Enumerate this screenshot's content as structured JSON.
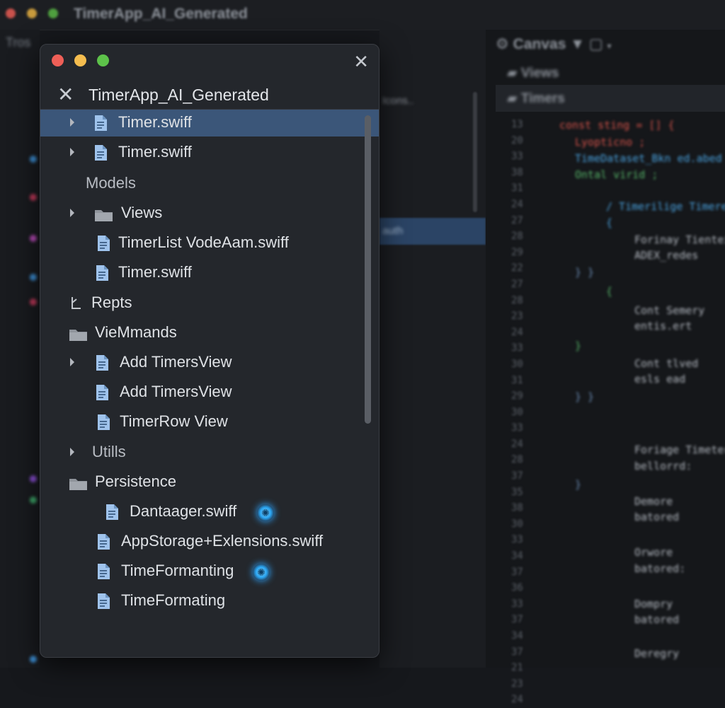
{
  "window": {
    "title": "TimerApp_AI_Generated"
  },
  "background": {
    "left_tab": "Tros",
    "middle_texts": [
      "Icons..",
      "auth"
    ],
    "canvas_label": "Canvas",
    "right_rows": [
      "Views",
      "Timers"
    ],
    "gutter_numbers": [
      "13",
      "20",
      "33",
      "38",
      "31",
      "24",
      "27",
      "28",
      "29",
      "22",
      "27",
      "28",
      "23",
      "24",
      "33",
      "30",
      "31",
      "29",
      "30",
      "33",
      "24",
      "28",
      "37",
      "35",
      "38",
      "30",
      "33",
      "34",
      "37",
      "36",
      "33",
      "37",
      "34",
      "37",
      "21",
      "23",
      "24"
    ],
    "code": [
      "const sting = [] {",
      "  Lyopticno ;",
      "  TimeDataset_Bkn ed.abed {",
      "  Ontal virid ;",
      "/ Timerilige Timeres",
      "{",
      "Forinay Tienteint",
      "ADEX_redes",
      "} }",
      "{",
      "Cont Semery",
      "entis.ert",
      "}",
      "Cont tlved",
      "esls ead",
      "} }",
      "Foriage Timeter",
      "bellorrd:",
      "}",
      "Demore",
      "batored",
      "Orwore",
      "batored:",
      "Dompry",
      "batored",
      "Deregry"
    ]
  },
  "panel": {
    "project_name": "TimerApp_AI_Generated",
    "items": [
      {
        "label": "Timer.swiff",
        "kind": "file",
        "chevron": true,
        "selected": true
      },
      {
        "label": "Timer.swiff",
        "kind": "file",
        "chevron": true
      },
      {
        "label": "Models",
        "kind": "group"
      },
      {
        "label": "Views",
        "kind": "folder",
        "chevron": true
      },
      {
        "label": "TimerList VodeAam.swiff",
        "kind": "file"
      },
      {
        "label": "Timer.swiff",
        "kind": "file"
      },
      {
        "label": "Repts",
        "kind": "person"
      },
      {
        "label": "VieMmands",
        "kind": "folder"
      },
      {
        "label": "Add TimersView",
        "kind": "file",
        "chevron": true
      },
      {
        "label": "Add TimersView",
        "kind": "file"
      },
      {
        "label": "TimerRow View",
        "kind": "file"
      },
      {
        "label": "Utills",
        "kind": "group",
        "chevron": true
      },
      {
        "label": "Persistence",
        "kind": "folder"
      },
      {
        "label": "Dantaager.swiff",
        "kind": "file",
        "badge": "ai-sparkle-icon"
      },
      {
        "label": "AppStorage+Exlensions.swiff",
        "kind": "file"
      },
      {
        "label": "TimeFormanting",
        "kind": "file",
        "badge": "ai-sparkle-icon"
      },
      {
        "label": "TimeFormating",
        "kind": "file"
      }
    ]
  },
  "colors": {
    "selection": "#3b5679",
    "file_icon": "#9fc3ec",
    "folder_icon": "#8f949b",
    "traffic_red": "#ee5f57",
    "traffic_yellow": "#f5bd4f",
    "traffic_green": "#5dc24a"
  }
}
